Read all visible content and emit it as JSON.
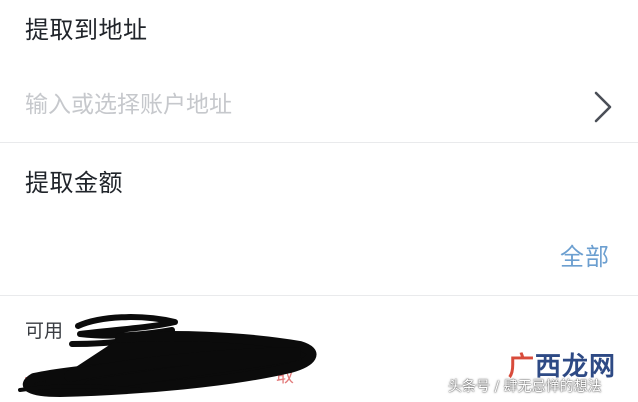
{
  "address_section": {
    "title": "提取到地址",
    "input_placeholder": "输入或选择账户地址",
    "input_value": ""
  },
  "amount_section": {
    "title": "提取金额",
    "input_value": "",
    "all_button_label": "全部"
  },
  "available": {
    "label": "可用"
  },
  "fee": {
    "trailing_char": "取"
  },
  "watermark": {
    "brand_first_char": "广",
    "brand_rest": "西龙网",
    "source": "头条号 / 肆无忌惮的想法"
  },
  "colors": {
    "link_blue": "#6c9fd0",
    "divider": "#e9eaec",
    "placeholder": "#c6c8cc",
    "warning_red": "#e27b7b"
  },
  "icons": {
    "address_select": "chevron-right-icon"
  }
}
